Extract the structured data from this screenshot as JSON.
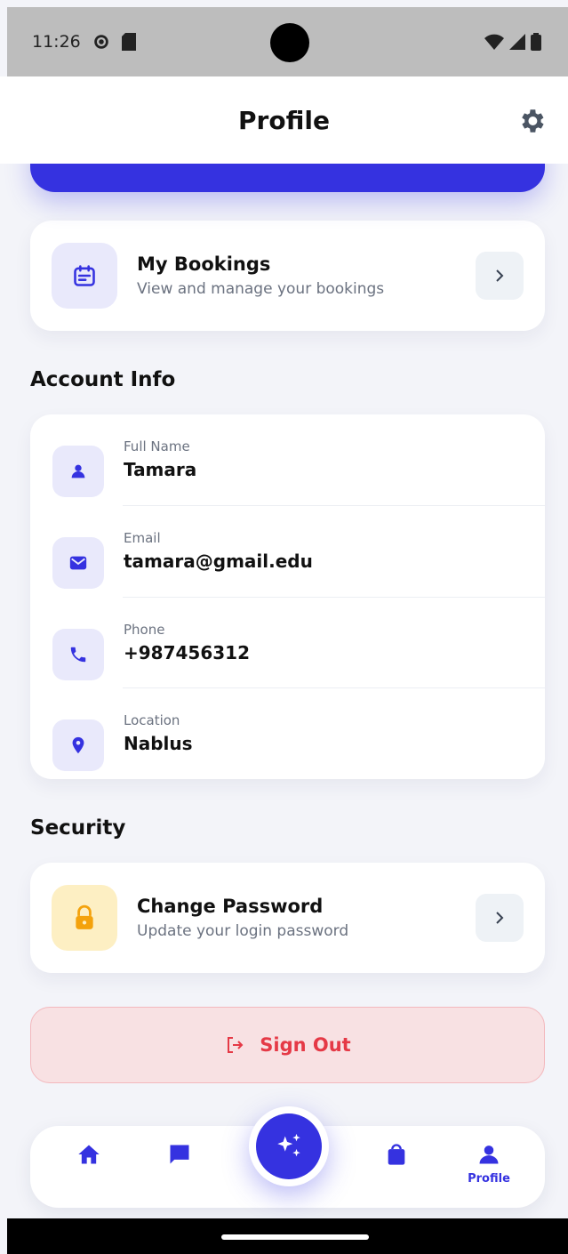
{
  "status_bar": {
    "time": "11:26"
  },
  "header": {
    "title": "Profile"
  },
  "bookings": {
    "title": "My Bookings",
    "subtitle": "View and manage your bookings"
  },
  "account_info": {
    "title": "Account Info",
    "rows": [
      {
        "label": "Full Name",
        "value": "Tamara",
        "icon": "person-icon"
      },
      {
        "label": "Email",
        "value": "tamara@gmail.edu",
        "icon": "mail-icon"
      },
      {
        "label": "Phone",
        "value": "+987456312",
        "icon": "phone-icon"
      },
      {
        "label": "Location",
        "value": "Nablus",
        "icon": "location-pin-icon"
      }
    ]
  },
  "security": {
    "title": "Security",
    "change_password": {
      "title": "Change Password",
      "subtitle": "Update your login password"
    }
  },
  "signout": {
    "label": "Sign Out"
  },
  "bottom_nav": {
    "active_label": "Profile"
  },
  "colors": {
    "primary": "#3532e0",
    "danger": "#e53946",
    "danger_bg": "#f8e1e3",
    "lock_bg": "#fdefc3",
    "lock_icon": "#f4a20c"
  }
}
